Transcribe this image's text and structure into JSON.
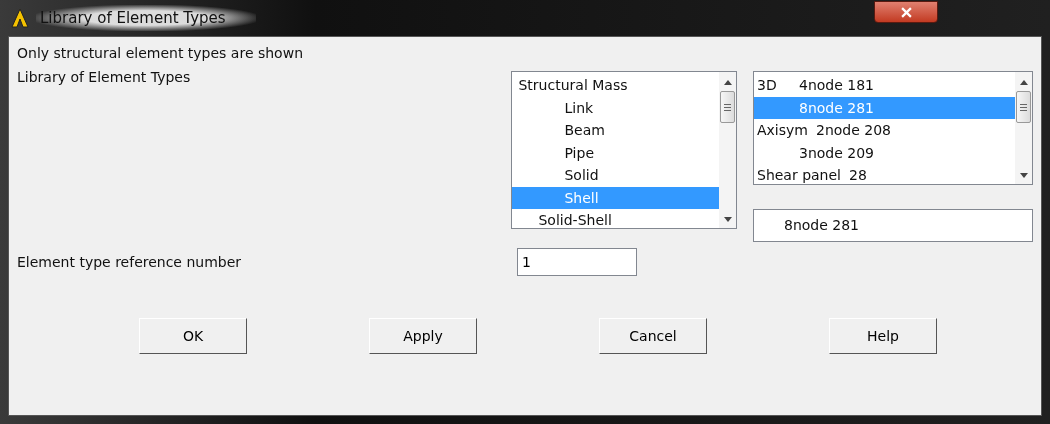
{
  "window": {
    "title": "Library of Element Types"
  },
  "note": "Only structural element types are shown",
  "library": {
    "label": "Library of Element Types",
    "categories": [
      {
        "label": "Structural Mass",
        "kind": "heading",
        "selected": false
      },
      {
        "label": "Link",
        "kind": "entry",
        "selected": false
      },
      {
        "label": "Beam",
        "kind": "entry",
        "selected": false
      },
      {
        "label": "Pipe",
        "kind": "entry",
        "selected": false
      },
      {
        "label": "Solid",
        "kind": "entry",
        "selected": false
      },
      {
        "label": "Shell",
        "kind": "entry",
        "selected": true
      },
      {
        "label": "Solid-Shell",
        "kind": "group",
        "selected": false
      }
    ],
    "types": [
      {
        "prefix": "3D",
        "label": "4node 181",
        "selected": false
      },
      {
        "label": "8node 281",
        "selected": true
      },
      {
        "prefix": "Axisym",
        "label": "2node 208",
        "selected": false
      },
      {
        "label": "3node 209",
        "selected": false
      },
      {
        "prefix": "Shear panel",
        "label": "28",
        "selected": false
      }
    ],
    "chosen": "8node 281"
  },
  "reference": {
    "label": "Element type reference number",
    "value": "1"
  },
  "buttons": [
    "OK",
    "Apply",
    "Cancel",
    "Help"
  ]
}
